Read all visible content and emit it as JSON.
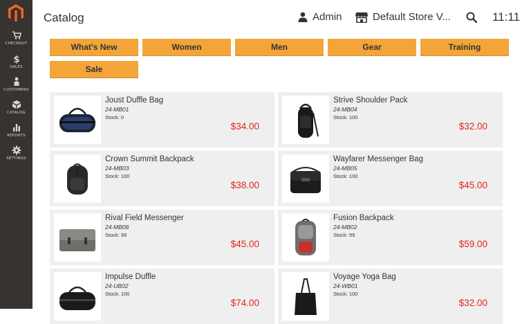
{
  "header": {
    "title": "Catalog",
    "user": "Admin",
    "store": "Default Store V...",
    "time": "11:11"
  },
  "sidebar": {
    "items": [
      {
        "label": "CHECKOUT",
        "icon": "cart-icon"
      },
      {
        "label": "SALES",
        "icon": "dollar-icon"
      },
      {
        "label": "CUSTOMERS",
        "icon": "customer-icon"
      },
      {
        "label": "CATALOG",
        "icon": "catalog-icon"
      },
      {
        "label": "REPORTS",
        "icon": "reports-icon"
      },
      {
        "label": "SETTINGS",
        "icon": "gear-icon"
      }
    ]
  },
  "categories": [
    "What's New",
    "Women",
    "Men",
    "Gear",
    "Training",
    "Sale"
  ],
  "products": [
    {
      "name": "Joust Duffle Bag",
      "sku": "24-MB01",
      "stock": "Stock: 0",
      "price": "$34.00"
    },
    {
      "name": "Strive Shoulder Pack",
      "sku": "24-MB04",
      "stock": "Stock: 100",
      "price": "$32.00"
    },
    {
      "name": "Crown Summit Backpack",
      "sku": "24-MB03",
      "stock": "Stock: 100",
      "price": "$38.00"
    },
    {
      "name": "Wayfarer Messenger Bag",
      "sku": "24-MB05",
      "stock": "Stock: 100",
      "price": "$45.00"
    },
    {
      "name": "Rival Field Messenger",
      "sku": "24-MB06",
      "stock": "Stock: 99",
      "price": "$45.00"
    },
    {
      "name": "Fusion Backpack",
      "sku": "24-MB02",
      "stock": "Stock: 99",
      "price": "$59.00"
    },
    {
      "name": "Impulse Duffle",
      "sku": "24-UB02",
      "stock": "Stock: 100",
      "price": "$74.00"
    },
    {
      "name": "Voyage Yoga Bag",
      "sku": "24-WB01",
      "stock": "Stock: 100",
      "price": "$32.00"
    }
  ],
  "colors": {
    "sidebar": "#373330",
    "accent": "#f3a539",
    "price": "#e0261d",
    "logo": "#f26322",
    "card": "#efefef"
  }
}
